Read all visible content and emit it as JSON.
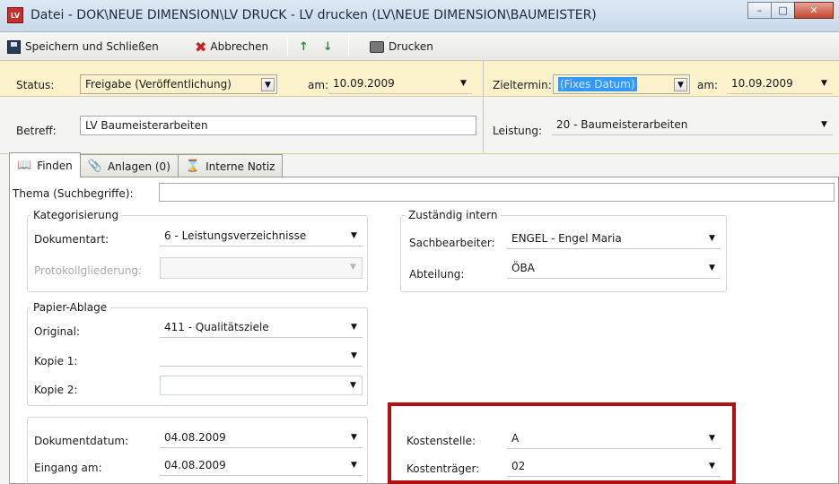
{
  "window": {
    "title": "Datei - DOK\\NEUE DIMENSION\\LV DRUCK - LV drucken (LV\\NEUE DIMENSION\\BAUMEISTER)",
    "icon_text": "LV",
    "controls": [
      "minimize-icon",
      "maximize-icon",
      "close-icon"
    ]
  },
  "toolbar": {
    "save_close": "Speichern und Schließen",
    "cancel": "Abbrechen",
    "print": "Drucken",
    "up_arrow": "↑",
    "down_arrow": "↓"
  },
  "header": {
    "status_label": "Status:",
    "status_value": "Freigabe (Veröffentlichung)",
    "am_label_1": "am:",
    "am_value_1": "10.09.2009",
    "zieltermin_label": "Zieltermin:",
    "zieltermin_value": "(Fixes Datum)",
    "am_label_2": "am:",
    "am_value_2": "10.09.2009",
    "betreff_label": "Betreff:",
    "betreff_value": "LV Baumeisterarbeiten",
    "leistung_label": "Leistung:",
    "leistung_value": "20 - Baumeisterarbeiten"
  },
  "tabs": [
    {
      "label": "Finden",
      "icon": "book-icon",
      "active": true
    },
    {
      "label": "Anlagen (0)",
      "icon": "paperclip-icon",
      "active": false
    },
    {
      "label": "Interne Notiz",
      "icon": "pin-icon",
      "active": false
    }
  ],
  "finden": {
    "thema_label": "Thema (Suchbegriffe):",
    "thema_value": "",
    "kategorisierung": {
      "title": "Kategorisierung",
      "dokumentart_label": "Dokumentart:",
      "dokumentart_value": "6 - Leistungsverzeichnisse",
      "protokoll_label": "Protokollgliederung:",
      "protokoll_value": ""
    },
    "zustaendig": {
      "title": "Zuständig intern",
      "sachbearbeiter_label": "Sachbearbeiter:",
      "sachbearbeiter_value": "ENGEL - Engel Maria",
      "abteilung_label": "Abteilung:",
      "abteilung_value": "ÖBA"
    },
    "papier": {
      "title": "Papier-Ablage",
      "original_label": "Original:",
      "original_value": "411 - Qualitätsziele",
      "kopie1_label": "Kopie 1:",
      "kopie1_value": "",
      "kopie2_label": "Kopie 2:",
      "kopie2_value": ""
    },
    "datum": {
      "dokumentdatum_label": "Dokumentdatum:",
      "dokumentdatum_value": "04.08.2009",
      "eingang_label": "Eingang am:",
      "eingang_value": "04.08.2009"
    },
    "kosten": {
      "kostenstelle_label": "Kostenstelle:",
      "kostenstelle_value": "A",
      "kostentraeger_label": "Kostenträger:",
      "kostentraeger_value": "02"
    }
  },
  "colors": {
    "header_band": "#fbf1cb",
    "highlight_frame": "#b30f0f",
    "selection": "#3399ff"
  }
}
